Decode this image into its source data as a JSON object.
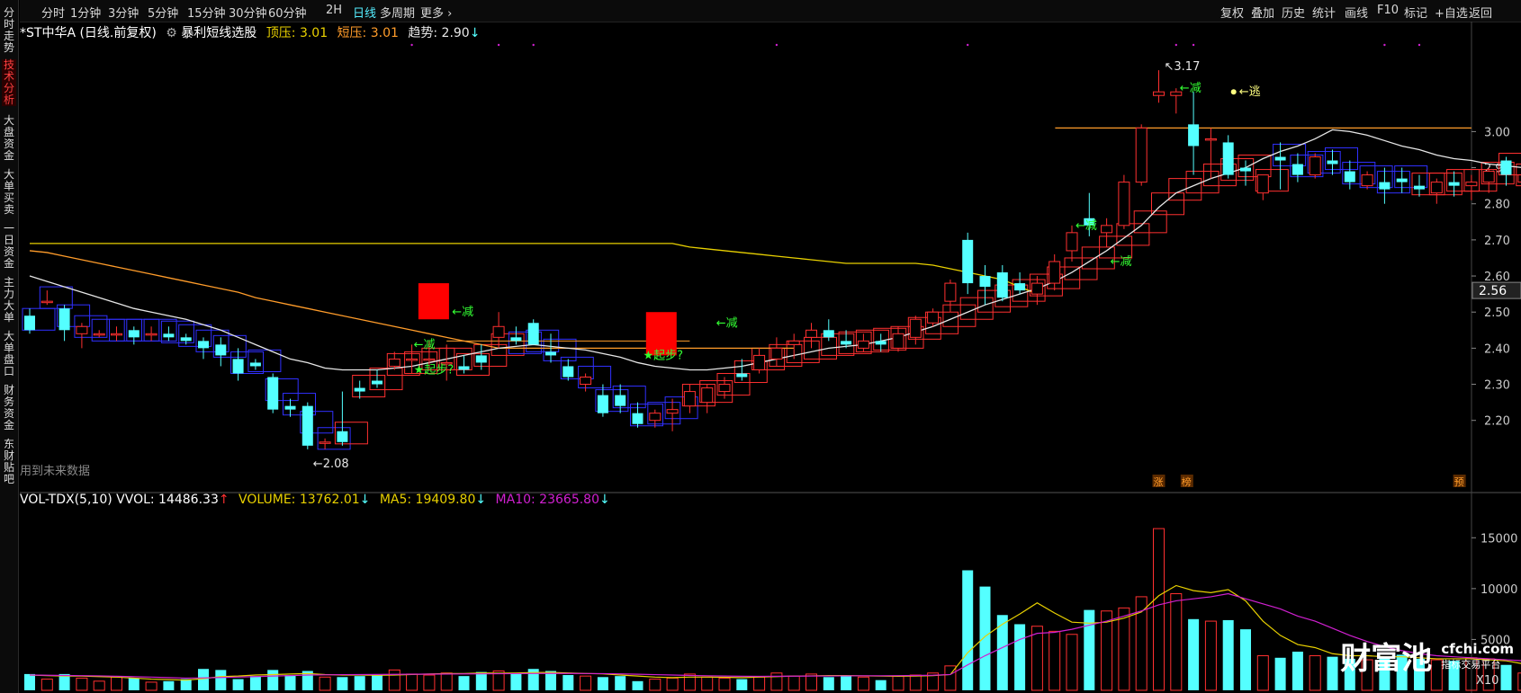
{
  "toolbar": {
    "left_items": [
      "分时",
      "1分钟",
      "3分钟",
      "5分钟",
      "15分钟",
      "30分钟",
      "60分钟",
      "2H",
      "日线",
      "多周期",
      "更多 ›"
    ],
    "active": "日线",
    "right_items": [
      "复权",
      "叠加",
      "历史",
      "统计",
      "画线",
      "F10",
      "标记",
      "+自选",
      "返回"
    ]
  },
  "sidebar": [
    "分时走势",
    "技术分析",
    "大盘资金",
    "大单买卖",
    "一日资金",
    "主力大单",
    "大单盘口",
    "财务资金",
    "东财贴吧"
  ],
  "sidebar_active": "技术分析",
  "info": {
    "stock": "*ST中华A (日线.前复权)",
    "indicator": "暴利短线选股",
    "top_label": "顶压:",
    "top_value": "3.01",
    "short_label": "短压:",
    "short_value": "3.01",
    "trend_label": "趋势:",
    "trend_value": "2.90"
  },
  "volinfo": {
    "name": "VOL-TDX(5,10)",
    "vvol": "VVOL: 14486.33",
    "volume": "VOLUME: 13762.01",
    "ma5": "MA5: 19409.80",
    "ma10": "MA10: 23665.80"
  },
  "future_note": "用到未来数据",
  "last_price": "2.56",
  "watermark": {
    "brand": "财富池",
    "site": "cfchi.com",
    "tagline": "指标交易平台",
    "x10": "X10"
  },
  "colors": {
    "up": "#ff3030",
    "down": "#54ffff",
    "ma_white": "#e6e6e6",
    "ma_yellow": "#e8d000",
    "ma_orange": "#ff9c2a",
    "channel_blue": "#3030ff",
    "signal_green": "#33ff33",
    "red_block": "#ff0000",
    "vol_ma5": "#e8d000",
    "vol_ma10": "#d020d0"
  },
  "chart_data": {
    "type": "candlestick",
    "y_axis": {
      "ticks": [
        "3.00",
        "2.90",
        "2.80",
        "2.70",
        "2.60",
        "2.50",
        "2.40",
        "2.30",
        "2.20"
      ],
      "min": 2.02,
      "max": 3.24
    },
    "annotations": {
      "high": "3.17",
      "low": "2.08",
      "labels": [
        "←减",
        "←减",
        "←减",
        "←减",
        "←减",
        "←减",
        "←逃"
      ],
      "starts": [
        "★起步?",
        "★起步?"
      ],
      "badges": [
        "涨",
        "榜",
        "预"
      ]
    },
    "candles": [
      [
        2.49,
        2.51,
        2.44,
        2.45
      ],
      [
        2.53,
        2.56,
        2.52,
        2.53
      ],
      [
        2.51,
        2.52,
        2.42,
        2.45
      ],
      [
        2.44,
        2.47,
        2.4,
        2.46
      ],
      [
        2.44,
        2.45,
        2.43,
        2.44
      ],
      [
        2.44,
        2.46,
        2.42,
        2.44
      ],
      [
        2.45,
        2.46,
        2.41,
        2.43
      ],
      [
        2.44,
        2.46,
        2.42,
        2.44
      ],
      [
        2.44,
        2.46,
        2.42,
        2.43
      ],
      [
        2.43,
        2.44,
        2.41,
        2.42
      ],
      [
        2.42,
        2.43,
        2.37,
        2.4
      ],
      [
        2.41,
        2.43,
        2.35,
        2.38
      ],
      [
        2.37,
        2.4,
        2.31,
        2.33
      ],
      [
        2.36,
        2.37,
        2.34,
        2.35
      ],
      [
        2.32,
        2.33,
        2.22,
        2.23
      ],
      [
        2.24,
        2.26,
        2.21,
        2.23
      ],
      [
        2.24,
        2.25,
        2.12,
        2.13
      ],
      [
        2.14,
        2.15,
        2.12,
        2.14
      ],
      [
        2.17,
        2.28,
        2.13,
        2.14
      ],
      [
        2.29,
        2.31,
        2.26,
        2.28
      ],
      [
        2.31,
        2.34,
        2.29,
        2.3
      ],
      [
        2.35,
        2.39,
        2.34,
        2.37
      ],
      [
        2.37,
        2.41,
        2.33,
        2.37
      ],
      [
        2.37,
        2.42,
        2.34,
        2.37
      ],
      [
        2.36,
        2.41,
        2.31,
        2.36
      ],
      [
        2.35,
        2.38,
        2.33,
        2.34
      ],
      [
        2.38,
        2.41,
        2.34,
        2.36
      ],
      [
        2.43,
        2.5,
        2.4,
        2.46
      ],
      [
        2.43,
        2.46,
        2.41,
        2.42
      ],
      [
        2.47,
        2.48,
        2.41,
        2.41
      ],
      [
        2.39,
        2.44,
        2.36,
        2.38
      ],
      [
        2.35,
        2.37,
        2.31,
        2.32
      ],
      [
        2.3,
        2.33,
        2.28,
        2.32
      ],
      [
        2.27,
        2.3,
        2.21,
        2.22
      ],
      [
        2.27,
        2.3,
        2.22,
        2.24
      ],
      [
        2.22,
        2.25,
        2.18,
        2.19
      ],
      [
        2.2,
        2.23,
        2.18,
        2.22
      ],
      [
        2.22,
        2.26,
        2.17,
        2.23
      ],
      [
        2.24,
        2.3,
        2.22,
        2.28
      ],
      [
        2.25,
        2.3,
        2.22,
        2.29
      ],
      [
        2.28,
        2.32,
        2.26,
        2.3
      ],
      [
        2.33,
        2.37,
        2.31,
        2.32
      ],
      [
        2.34,
        2.4,
        2.33,
        2.38
      ],
      [
        2.37,
        2.43,
        2.35,
        2.4
      ],
      [
        2.41,
        2.44,
        2.37,
        2.42
      ],
      [
        2.43,
        2.47,
        2.4,
        2.45
      ],
      [
        2.45,
        2.48,
        2.42,
        2.43
      ],
      [
        2.42,
        2.45,
        2.4,
        2.41
      ],
      [
        2.4,
        2.44,
        2.39,
        2.42
      ],
      [
        2.42,
        2.44,
        2.39,
        2.41
      ],
      [
        2.4,
        2.46,
        2.39,
        2.44
      ],
      [
        2.43,
        2.49,
        2.41,
        2.48
      ],
      [
        2.47,
        2.51,
        2.46,
        2.5
      ],
      [
        2.53,
        2.59,
        2.5,
        2.58
      ],
      [
        2.7,
        2.72,
        2.55,
        2.58
      ],
      [
        2.6,
        2.63,
        2.52,
        2.57
      ],
      [
        2.61,
        2.63,
        2.53,
        2.54
      ],
      [
        2.58,
        2.61,
        2.55,
        2.56
      ],
      [
        2.55,
        2.6,
        2.52,
        2.58
      ],
      [
        2.58,
        2.66,
        2.56,
        2.64
      ],
      [
        2.67,
        2.74,
        2.64,
        2.72
      ],
      [
        2.76,
        2.83,
        2.71,
        2.74
      ],
      [
        2.72,
        2.76,
        2.68,
        2.74
      ],
      [
        2.74,
        2.88,
        2.73,
        2.86
      ],
      [
        2.86,
        3.02,
        2.85,
        3.01
      ],
      [
        3.1,
        3.17,
        3.08,
        3.11
      ],
      [
        3.1,
        3.12,
        3.05,
        3.11
      ],
      [
        3.02,
        3.11,
        2.88,
        2.96
      ],
      [
        2.98,
        3.01,
        2.87,
        2.98
      ],
      [
        2.97,
        2.99,
        2.87,
        2.88
      ],
      [
        2.9,
        2.92,
        2.85,
        2.89
      ],
      [
        2.83,
        2.88,
        2.81,
        2.88
      ],
      [
        2.93,
        2.97,
        2.84,
        2.92
      ],
      [
        2.91,
        2.94,
        2.86,
        2.88
      ],
      [
        2.88,
        2.94,
        2.87,
        2.93
      ],
      [
        2.92,
        2.95,
        2.88,
        2.91
      ],
      [
        2.89,
        2.92,
        2.84,
        2.86
      ],
      [
        2.85,
        2.89,
        2.84,
        2.88
      ],
      [
        2.86,
        2.9,
        2.8,
        2.84
      ],
      [
        2.87,
        2.9,
        2.83,
        2.86
      ],
      [
        2.85,
        2.88,
        2.82,
        2.84
      ],
      [
        2.83,
        2.87,
        2.8,
        2.86
      ],
      [
        2.86,
        2.89,
        2.82,
        2.85
      ],
      [
        2.85,
        2.88,
        2.81,
        2.86
      ],
      [
        2.86,
        2.9,
        2.83,
        2.89
      ],
      [
        2.92,
        2.93,
        2.85,
        2.88
      ],
      [
        2.86,
        2.89,
        2.84,
        2.88
      ]
    ],
    "volume": {
      "ticks": [
        "15000",
        "10000",
        "5000"
      ],
      "max": 17500,
      "values": [
        1600,
        1100,
        1600,
        1200,
        900,
        1300,
        1200,
        800,
        900,
        1100,
        2100,
        2000,
        1100,
        1400,
        2000,
        1500,
        1900,
        1300,
        1300,
        1400,
        1500,
        2000,
        1600,
        1500,
        1700,
        1400,
        1800,
        1900,
        1600,
        2100,
        1900,
        1500,
        1400,
        1300,
        1400,
        900,
        1100,
        1200,
        1600,
        1300,
        1200,
        1100,
        1300,
        1700,
        1400,
        1600,
        1300,
        1400,
        1300,
        1000,
        1400,
        1500,
        1700,
        2400,
        11800,
        10200,
        7400,
        6500,
        6300,
        5800,
        5500,
        7900,
        7800,
        8100,
        9200,
        15900,
        9500,
        7000,
        6800,
        6900,
        6000,
        3400,
        3200,
        3800,
        3400,
        3300,
        3100,
        3000,
        3200,
        3500,
        3100,
        3000,
        2900,
        3200,
        3100,
        2500,
        1700
      ],
      "ma5": [
        1500,
        1450,
        1400,
        1400,
        1350,
        1300,
        1200,
        1100,
        1050,
        1000,
        1150,
        1350,
        1400,
        1500,
        1550,
        1600,
        1650,
        1550,
        1500,
        1500,
        1480,
        1500,
        1560,
        1600,
        1650,
        1650,
        1700,
        1680,
        1700,
        1750,
        1760,
        1700,
        1650,
        1620,
        1500,
        1400,
        1300,
        1250,
        1300,
        1300,
        1280,
        1250,
        1300,
        1350,
        1400,
        1420,
        1450,
        1450,
        1420,
        1400,
        1380,
        1400,
        1450,
        1550,
        3700,
        5300,
        6500,
        7500,
        8600,
        7600,
        6700,
        6600,
        6700,
        7100,
        7700,
        9300,
        10300,
        9800,
        9600,
        9900,
        8800,
        6800,
        5400,
        4500,
        4200,
        3600,
        3400,
        3400,
        3300,
        3300,
        3200,
        3100,
        3100,
        3100,
        3000,
        2900,
        2600
      ],
      "ma10": [
        1500,
        1480,
        1460,
        1440,
        1420,
        1380,
        1340,
        1300,
        1250,
        1200,
        1220,
        1260,
        1300,
        1350,
        1400,
        1450,
        1500,
        1520,
        1540,
        1550,
        1560,
        1570,
        1580,
        1590,
        1600,
        1610,
        1620,
        1630,
        1640,
        1650,
        1660,
        1660,
        1650,
        1640,
        1620,
        1580,
        1540,
        1500,
        1460,
        1430,
        1400,
        1380,
        1370,
        1380,
        1390,
        1400,
        1410,
        1420,
        1430,
        1430,
        1440,
        1460,
        1480,
        1550,
        2500,
        3400,
        4200,
        5000,
        5600,
        5700,
        6000,
        6400,
        6800,
        7300,
        7800,
        8400,
        8800,
        9000,
        9200,
        9500,
        9000,
        8500,
        8000,
        7300,
        6800,
        6100,
        5400,
        4800,
        4300,
        3900,
        3600,
        3400,
        3300,
        3200,
        3100,
        3000,
        2900
      ]
    },
    "ma_white": [
      2.6,
      2.585,
      2.57,
      2.555,
      2.54,
      2.525,
      2.51,
      2.5,
      2.49,
      2.48,
      2.465,
      2.45,
      2.43,
      2.41,
      2.39,
      2.37,
      2.36,
      2.345,
      2.34,
      2.34,
      2.34,
      2.345,
      2.35,
      2.36,
      2.37,
      2.38,
      2.39,
      2.4,
      2.405,
      2.41,
      2.405,
      2.4,
      2.395,
      2.385,
      2.375,
      2.36,
      2.35,
      2.345,
      2.34,
      2.34,
      2.345,
      2.35,
      2.36,
      2.37,
      2.38,
      2.39,
      2.4,
      2.405,
      2.41,
      2.42,
      2.43,
      2.445,
      2.46,
      2.48,
      2.5,
      2.52,
      2.535,
      2.55,
      2.565,
      2.585,
      2.61,
      2.64,
      2.67,
      2.705,
      2.74,
      2.79,
      2.83,
      2.85,
      2.87,
      2.885,
      2.9,
      2.925,
      2.945,
      2.96,
      2.98,
      3.005,
      3.0,
      2.99,
      2.975,
      2.96,
      2.95,
      2.935,
      2.925,
      2.92,
      2.91,
      2.905,
      2.9
    ],
    "ma_yellow": [
      2.69,
      2.69,
      2.69,
      2.69,
      2.69,
      2.69,
      2.69,
      2.69,
      2.69,
      2.69,
      2.69,
      2.69,
      2.69,
      2.69,
      2.69,
      2.69,
      2.69,
      2.69,
      2.69,
      2.69,
      2.69,
      2.69,
      2.69,
      2.69,
      2.69,
      2.69,
      2.69,
      2.69,
      2.69,
      2.69,
      2.69,
      2.69,
      2.69,
      2.69,
      2.69,
      2.69,
      2.69,
      2.69,
      2.68,
      2.675,
      2.67,
      2.665,
      2.66,
      2.655,
      2.65,
      2.645,
      2.64,
      2.635,
      2.635,
      2.635,
      2.635,
      2.635,
      2.63,
      2.62,
      2.61,
      2.6,
      2.59,
      2.57,
      2.55
    ],
    "ma_orange": [
      2.67,
      2.665,
      2.655,
      2.645,
      2.635,
      2.625,
      2.615,
      2.605,
      2.595,
      2.585,
      2.575,
      2.565,
      2.555,
      2.54,
      2.53,
      2.52,
      2.51,
      2.5,
      2.49,
      2.48,
      2.47,
      2.46,
      2.45,
      2.44,
      2.43,
      2.42,
      2.41,
      2.4,
      2.4,
      2.4,
      2.4,
      2.4,
      2.4,
      2.4,
      2.4,
      2.4,
      2.4,
      2.4,
      2.4,
      2.4,
      2.4,
      2.4,
      2.4,
      2.4,
      2.4
    ],
    "resistance_line": {
      "start": 58,
      "end": 83,
      "value": 3.01
    }
  }
}
